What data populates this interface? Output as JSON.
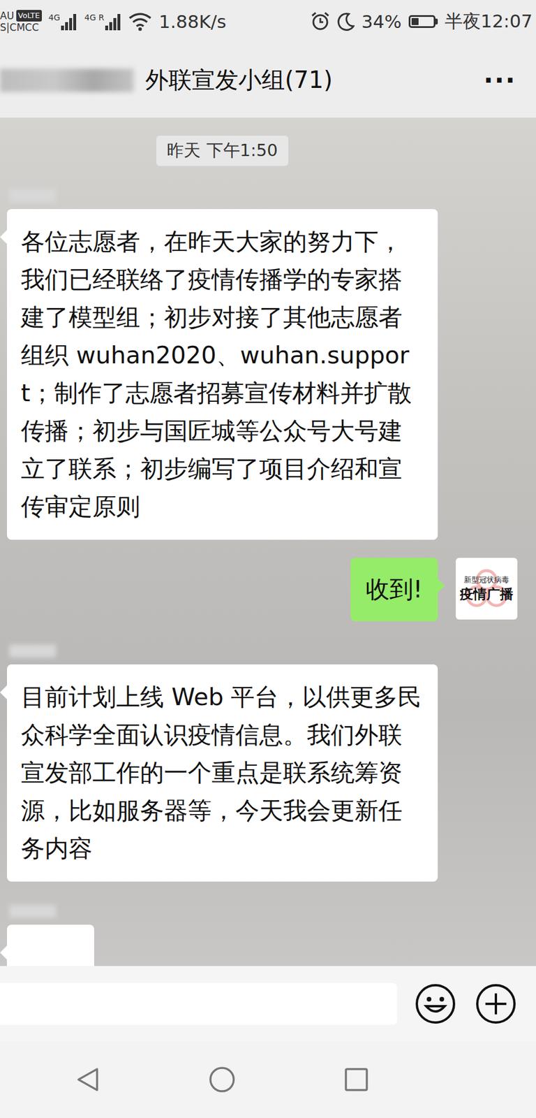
{
  "status_bar": {
    "carrier_top": "AU",
    "volte": "VoLTE",
    "carrier_bottom": "S|CMCC",
    "net1": "4G",
    "net2": "4G R",
    "speed": "1.88K/s",
    "battery": "34%",
    "battery_level": 0.34,
    "time": "半夜12:07"
  },
  "header": {
    "title": "外联宣发小组(71)",
    "more": "···"
  },
  "chat": {
    "timestamp": "昨天 下午1:50",
    "messages": [
      {
        "kind": "incoming",
        "text": "各位志愿者，在昨天大家的努力下，我们已经联络了疫情传播学的专家搭建了模型组；初步对接了其他志愿者组织 wuhan2020、wuhan.support；制作了志愿者招募宣传材料并扩散传播；初步与国匠城等公众号大号建立了联系；初步编写了项目介绍和宣传审定原则"
      },
      {
        "kind": "outgoing",
        "text": "收到!",
        "avatar_top": "新型冠状病毒",
        "avatar_main": "疫情广播"
      },
      {
        "kind": "incoming",
        "text": "目前计划上线 Web 平台，以供更多民众科学全面认识疫情信息。我们外联宣发部工作的一个重点是联系统筹资源，比如服务器等，今天我会更新任务内容"
      },
      {
        "kind": "partial",
        "text": ""
      }
    ]
  }
}
